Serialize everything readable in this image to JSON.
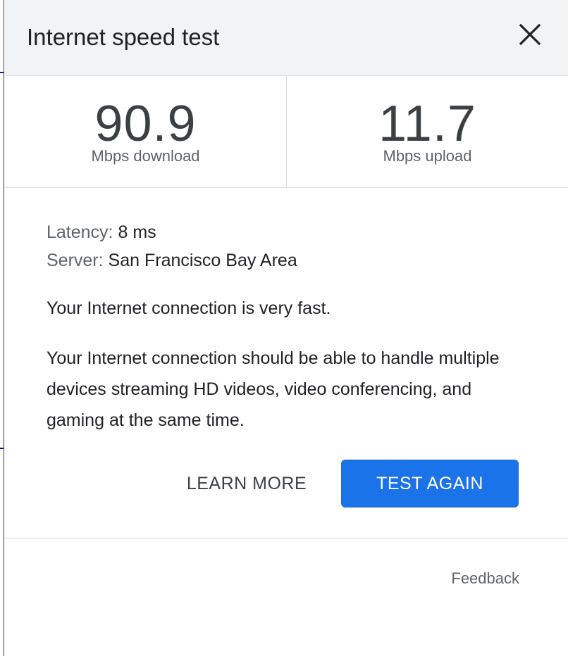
{
  "dialog": {
    "title": "Internet speed test",
    "close_icon": "close-icon"
  },
  "metrics": {
    "download": {
      "value": "90.9",
      "unit": "Mbps download"
    },
    "upload": {
      "value": "11.7",
      "unit": "Mbps upload"
    }
  },
  "details": {
    "latency_label": "Latency:",
    "latency_value": "8 ms",
    "server_label": "Server:",
    "server_value": "San Francisco Bay Area"
  },
  "messages": {
    "summary": "Your Internet connection is very fast.",
    "description": "Your Internet connection should be able to handle multiple devices streaming HD videos, video conferencing, and gaming at the same time."
  },
  "actions": {
    "learn_more": "LEARN MORE",
    "test_again": "TEST AGAIN"
  },
  "footer": {
    "feedback": "Feedback"
  },
  "colors": {
    "header_bg": "#f1f3f4",
    "primary_button": "#1a73e8",
    "text": "#202124",
    "secondary_text": "#5f6368",
    "divider": "#dadce0"
  }
}
